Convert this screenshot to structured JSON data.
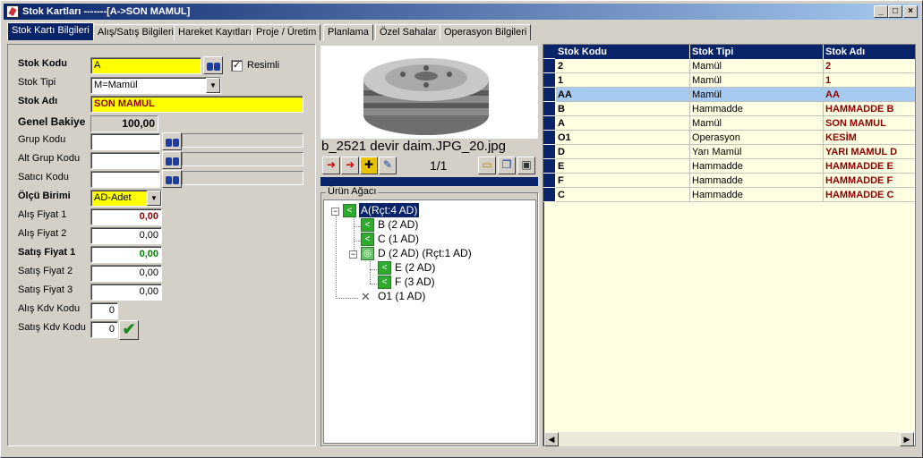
{
  "window": {
    "title": "Stok Kartları -------[A->SON MAMUL]"
  },
  "tabs": [
    "Stok Kartı Bilgileri",
    "Alış/Satış Bilgileri",
    "Hareket Kayıtları",
    "Proje / Üretim",
    "Planlama",
    "Özel Sahalar",
    "Operasyon Bilgileri"
  ],
  "form": {
    "stok_kodu_label": "Stok Kodu",
    "stok_kodu": "A",
    "resimli_label": "Resimli",
    "resimli_check": "✓",
    "stok_tipi_label": "Stok Tipi",
    "stok_tipi": "M=Mamül",
    "stok_adi_label": "Stok Adı",
    "stok_adi": "SON MAMUL",
    "genel_bakiye_label": "Genel Bakiye",
    "genel_bakiye": "100,00",
    "grup_kodu_label": "Grup Kodu",
    "alt_grup_kodu_label": "Alt Grup Kodu",
    "satici_kodu_label": "Satıcı Kodu",
    "olcu_birimi_label": "Ölçü Birimi",
    "olcu_birimi": "AD-Adet",
    "alis_fiyat1_label": "Alış Fiyat 1",
    "alis_fiyat1": "0,00",
    "alis_fiyat2_label": "Alış Fiyat 2",
    "alis_fiyat2": "0,00",
    "satis_fiyat1_label": "Satış Fiyat 1",
    "satis_fiyat1": "0,00",
    "satis_fiyat2_label": "Satış Fiyat 2",
    "satis_fiyat2": "0,00",
    "satis_fiyat3_label": "Satış Fiyat 3",
    "satis_fiyat3": "0,00",
    "alis_kdv_label": "Alış Kdv Kodu",
    "alis_kdv": "0",
    "satis_kdv_label": "Satış Kdv Kodu",
    "satis_kdv": "0"
  },
  "image": {
    "caption": "b_2521 devir daim.JPG_20.jpg",
    "counter": "1/1"
  },
  "tree": {
    "title": "Ürün Ağacı",
    "nodes": [
      "A(Rçt:4 AD)",
      "B (2 AD)",
      "C (1 AD)",
      "D (2 AD) (Rçt:1 AD)",
      "E (2 AD)",
      "F (3 AD)",
      "O1 (1 AD)"
    ]
  },
  "grid": {
    "headers": [
      "Stok Kodu",
      "Stok Tipi",
      "Stok Adı"
    ],
    "rows": [
      [
        "2",
        "Mamül",
        "2"
      ],
      [
        "1",
        "Mamül",
        "1"
      ],
      [
        "AA",
        "Mamül",
        "AA"
      ],
      [
        "B",
        "Hammadde",
        "HAMMADDE B"
      ],
      [
        "A",
        "Mamül",
        "SON MAMUL"
      ],
      [
        "O1",
        "Operasyon",
        "KESİM"
      ],
      [
        "D",
        "Yarı Mamül",
        "YARI MAMUL D"
      ],
      [
        "E",
        "Hammadde",
        "HAMMADDE E"
      ],
      [
        "F",
        "Hammadde",
        "HAMMADDE F"
      ],
      [
        "C",
        "Hammadde",
        "HAMMADDE C"
      ]
    ]
  },
  "colors": {
    "title_bar": "#0a246a",
    "required_field": "#ffff00",
    "grid_bg": "#ffffe1",
    "selected_row": "#a6caf0"
  }
}
